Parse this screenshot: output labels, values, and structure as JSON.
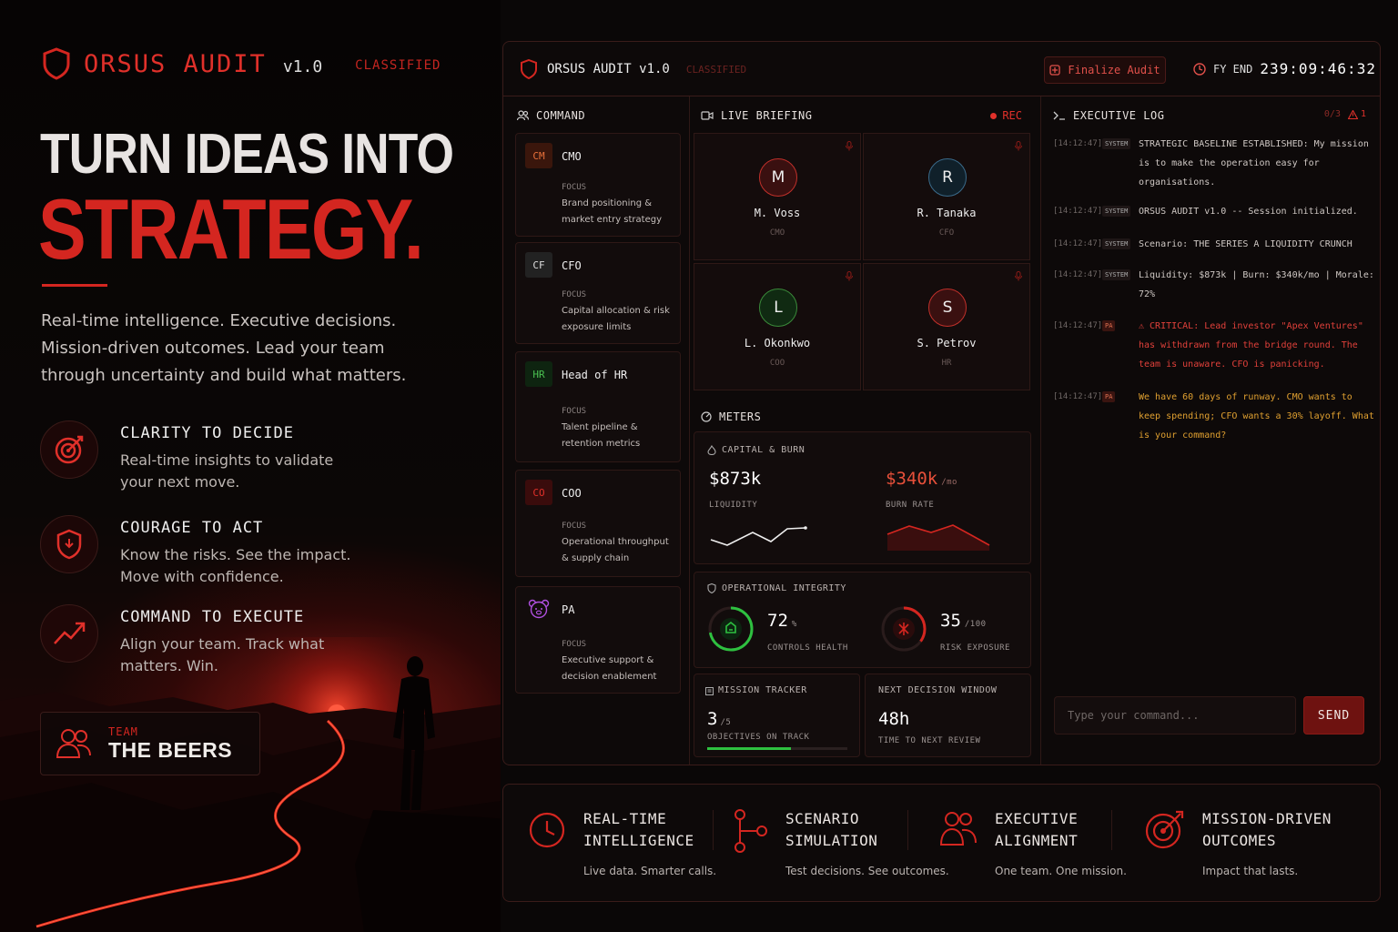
{
  "brand": {
    "name": "ORSUS AUDIT",
    "version": "v1.0",
    "classification": "CLASSIFIED"
  },
  "hero": {
    "headline_line1": "TURN IDEAS INTO",
    "headline_line2": "STRATEGY.",
    "lead": "Real-time intelligence. Executive decisions. Mission-driven outcomes. Lead your team through uncertainty and build what matters.",
    "features": [
      {
        "icon": "target-icon",
        "title": "CLARITY TO DECIDE",
        "desc": "Real-time insights to validate your next move."
      },
      {
        "icon": "shield-icon",
        "title": "COURAGE TO ACT",
        "desc": "Know the risks. See the impact. Move with confidence."
      },
      {
        "icon": "trend-up-icon",
        "title": "COMMAND TO EXECUTE",
        "desc": "Align your team. Track what matters. Win."
      }
    ],
    "team": {
      "label": "TEAM",
      "name": "THE BEERS"
    }
  },
  "dashboard": {
    "title": "ORSUS AUDIT v1.0",
    "classification": "CLASSIFIED",
    "finalize_label": "Finalize Audit",
    "fy_label": "FY END",
    "fy_countdown": "239:09:46:32",
    "command": {
      "header": "COMMAND",
      "cards": [
        {
          "abbr": "CM",
          "role": "CMO",
          "focus_label": "FOCUS",
          "focus": "Brand positioning & market entry strategy",
          "color": "#e0502a"
        },
        {
          "abbr": "CF",
          "role": "CFO",
          "focus_label": "FOCUS",
          "focus": "Capital allocation & risk exposure limits",
          "color": "#cfcfcf"
        },
        {
          "abbr": "HR",
          "role": "Head of HR",
          "focus_label": "FOCUS",
          "focus": "Talent pipeline & retention metrics",
          "color": "#3fb04a"
        },
        {
          "abbr": "CO",
          "role": "COO",
          "focus_label": "FOCUS",
          "focus": "Operational throughput & supply chain",
          "color": "#d42620"
        },
        {
          "abbr": "",
          "role": "PA",
          "focus_label": "FOCUS",
          "focus": "Executive support & decision enablement",
          "color": "#a040d0",
          "icon": "bear-icon"
        }
      ]
    },
    "briefing": {
      "header": "LIVE BRIEFING",
      "rec_label": "REC",
      "people": [
        {
          "initial": "M",
          "name": "M. Voss",
          "role": "CMO",
          "color": "#c0302a"
        },
        {
          "initial": "R",
          "name": "R. Tanaka",
          "role": "CFO",
          "color": "#3a6a8a"
        },
        {
          "initial": "L",
          "name": "L. Okonkwo",
          "role": "COO",
          "color": "#3a8a3a"
        },
        {
          "initial": "S",
          "name": "S. Petrov",
          "role": "HR",
          "color": "#c0302a"
        }
      ]
    },
    "meters": {
      "header": "METERS",
      "capital": {
        "label": "CAPITAL & BURN",
        "liquidity_value": "$873k",
        "liquidity_label": "LIQUIDITY",
        "burn_value": "$340k",
        "burn_unit": "/mo",
        "burn_label": "BURN RATE"
      },
      "integrity": {
        "label": "OPERATIONAL INTEGRITY",
        "controls_value": "72",
        "controls_unit": "%",
        "controls_label": "CONTROLS HEALTH",
        "controls_fraction": 0.72,
        "risk_value": "35",
        "risk_unit": "/100",
        "risk_label": "RISK EXPOSURE",
        "risk_fraction": 0.35
      },
      "mission": {
        "label": "MISSION TRACKER",
        "value": "3",
        "unit": "/5",
        "sub": "OBJECTIVES ON TRACK",
        "fraction": 0.6
      },
      "decision": {
        "label": "NEXT DECISION WINDOW",
        "value": "48h",
        "sub": "TIME TO NEXT REVIEW"
      }
    },
    "log": {
      "header": "EXECUTIVE LOG",
      "counter": "0/3",
      "alerts": "1",
      "entries": [
        {
          "ts": "[14:12:47]",
          "tag": "SYSTEM",
          "msg": "STRATEGIC BASELINE ESTABLISHED: My mission is to make the operation easy for organisations.",
          "color": "#cfc8c4"
        },
        {
          "ts": "[14:12:47]",
          "tag": "SYSTEM",
          "msg": "ORSUS AUDIT v1.0 -- Session initialized.",
          "color": "#cfc8c4"
        },
        {
          "ts": "[14:12:47]",
          "tag": "SYSTEM",
          "msg": "Scenario: THE SERIES A LIQUIDITY CRUNCH",
          "color": "#cfc8c4"
        },
        {
          "ts": "[14:12:47]",
          "tag": "SYSTEM",
          "msg": "Liquidity: $873k | Burn: $340k/mo | Morale: 72%",
          "color": "#cfc8c4"
        },
        {
          "ts": "[14:12:47]",
          "tag": "PA",
          "msg": "⚠ CRITICAL: Lead investor \"Apex Ventures\" has withdrawn from the bridge round. The team is unaware. CFO is panicking.",
          "color": "#e0403a"
        },
        {
          "ts": "[14:12:47]",
          "tag": "PA",
          "msg": "We have 60 days of runway. CMO wants to keep spending; CFO wants a 30% layoff. What is your command?",
          "color": "#e0a030"
        }
      ],
      "input_placeholder": "Type your command...",
      "send_label": "SEND"
    }
  },
  "bottom": [
    {
      "icon": "clock-icon",
      "title": "REAL-TIME INTELLIGENCE",
      "desc": "Live data. Smarter calls."
    },
    {
      "icon": "branch-icon",
      "title": "SCENARIO SIMULATION",
      "desc": "Test decisions. See outcomes."
    },
    {
      "icon": "users-icon",
      "title": "EXECUTIVE ALIGNMENT",
      "desc": "One team. One mission."
    },
    {
      "icon": "target-icon",
      "title": "MISSION-DRIVEN OUTCOMES",
      "desc": "Impact that lasts."
    }
  ],
  "colors": {
    "accent": "#d42620",
    "background": "#0a0707",
    "panel": "#120c0c",
    "border": "#2e1816"
  }
}
